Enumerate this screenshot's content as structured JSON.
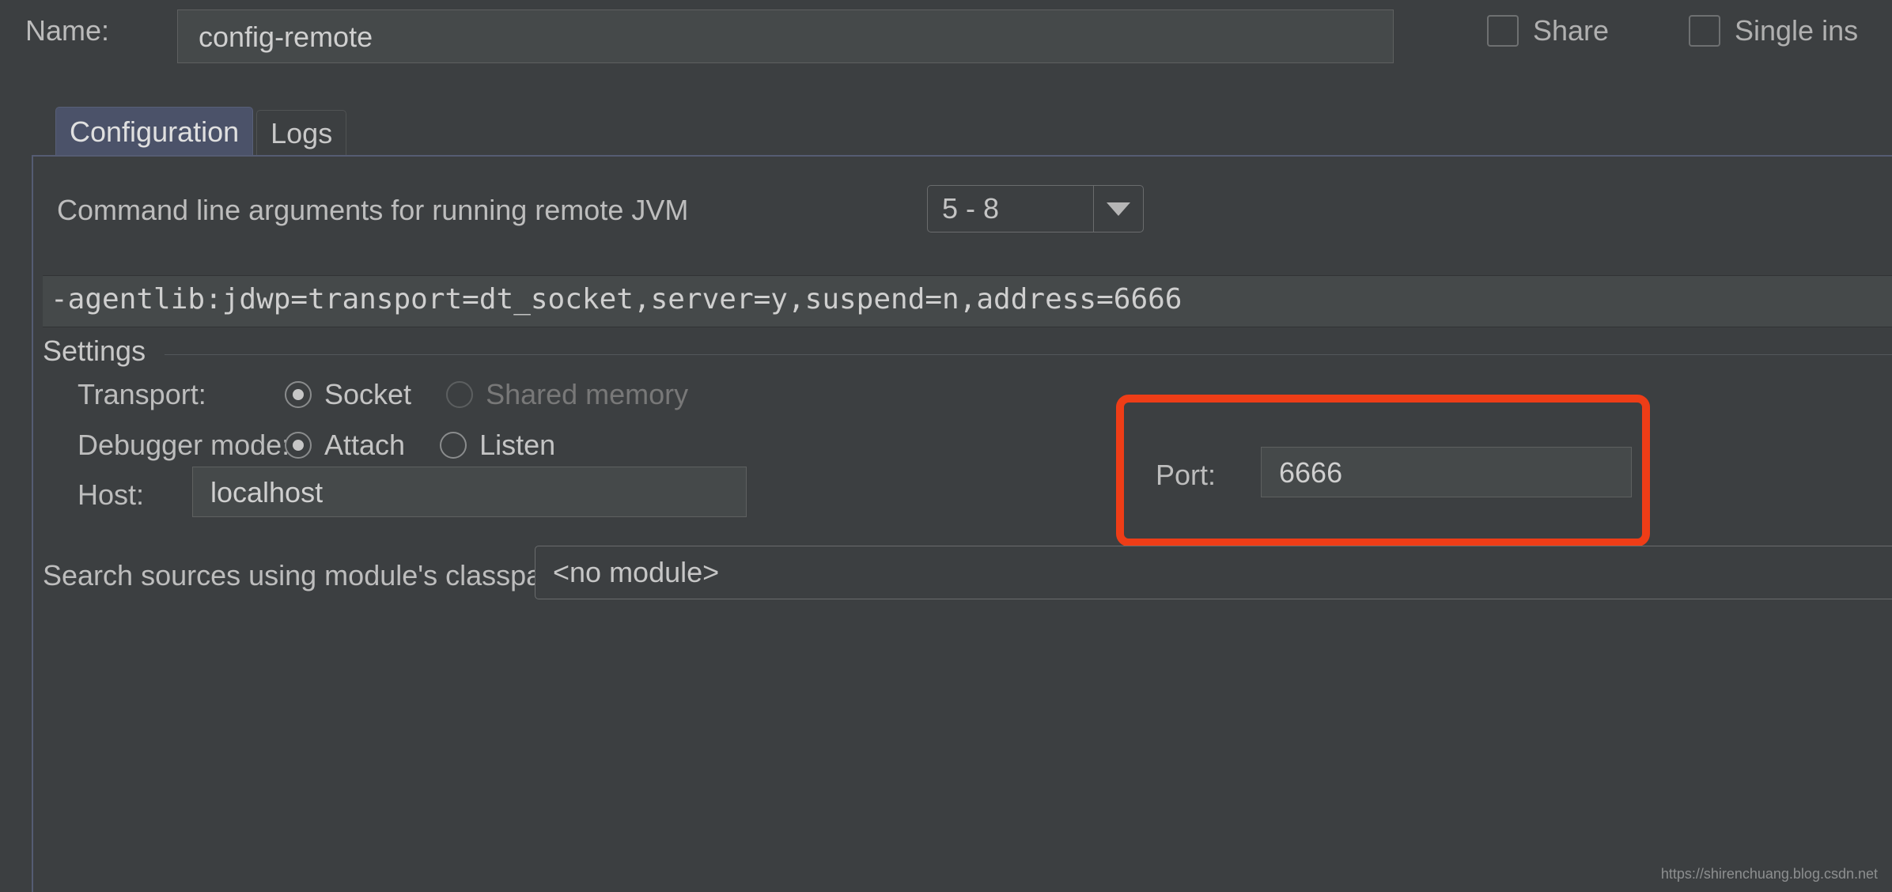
{
  "header": {
    "name_label": "Name:",
    "name_value": "config-remote",
    "share": {
      "label": "Share",
      "checked": false
    },
    "single_instance": {
      "label": "Single ins",
      "checked": false
    }
  },
  "tabs": [
    {
      "label": "Configuration",
      "active": true
    },
    {
      "label": "Logs",
      "active": false
    }
  ],
  "configuration": {
    "jvm_args": {
      "label": "Command line arguments for running remote JVM",
      "selected": "5 - 8",
      "arrow_icon": "chevron-down-icon"
    },
    "command_line": "-agentlib:jdwp=transport=dt_socket,server=y,suspend=n,address=6666",
    "settings": {
      "title": "Settings",
      "transport": {
        "label": "Transport:",
        "options": [
          {
            "label": "Socket",
            "selected": true,
            "disabled": false
          },
          {
            "label": "Shared memory",
            "selected": false,
            "disabled": true
          }
        ]
      },
      "debugger_mode": {
        "label": "Debugger mode:",
        "options": [
          {
            "label": "Attach",
            "selected": true,
            "disabled": false
          },
          {
            "label": "Listen",
            "selected": false,
            "disabled": false
          }
        ]
      },
      "host": {
        "label": "Host:",
        "value": "localhost"
      },
      "port": {
        "label": "Port:",
        "value": "6666"
      }
    },
    "search_sources": {
      "label": "Search sources using module's classpath:",
      "value": "<no module>"
    }
  },
  "annotation": {
    "highlight_color": "#ee3d17",
    "target": "port-field"
  },
  "watermark": "https://shirenchuang.blog.csdn.net"
}
